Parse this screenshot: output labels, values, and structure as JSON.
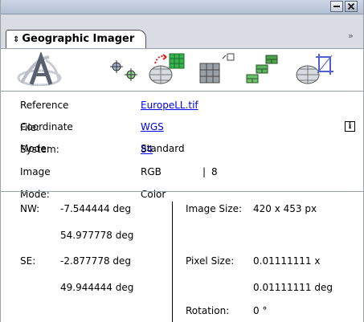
{
  "panel": {
    "tab_label": "Geographic Imager",
    "tab_arrow": "⇕",
    "menu_chevron": "»"
  },
  "toolbar": {
    "icons": [
      "logo-icon",
      "georeference-icon",
      "transform-icon",
      "mosaic-icon",
      "tile-icon",
      "reproject-icon",
      "crop-icon"
    ]
  },
  "info": {
    "reference_file_label": "Reference File:",
    "reference_file_value": "EuropeLL.tif",
    "coordinate_system_label": "Coordinate System:",
    "coordinate_system_value": "WGS 84",
    "info_button": "i",
    "mode_label": "Mode:",
    "mode_value": "Standard",
    "image_mode_label": "Image Mode:",
    "image_mode_value": "RGB Color",
    "bit_depth": "8"
  },
  "bounds": {
    "nw_label": "NW:",
    "nw_x": "-7.544444 deg",
    "nw_y": "54.977778 deg",
    "se_label": "SE:",
    "se_x": "-2.877778 deg",
    "se_y": "49.944444 deg"
  },
  "image": {
    "size_label": "Image Size:",
    "size_value": "420 x 453 px",
    "pixel_size_label": "Pixel Size:",
    "pixel_size_x": "0.01111111 x",
    "pixel_size_y": "0.01111111 deg",
    "rotation_label": "Rotation:",
    "rotation_value": "0 °"
  }
}
